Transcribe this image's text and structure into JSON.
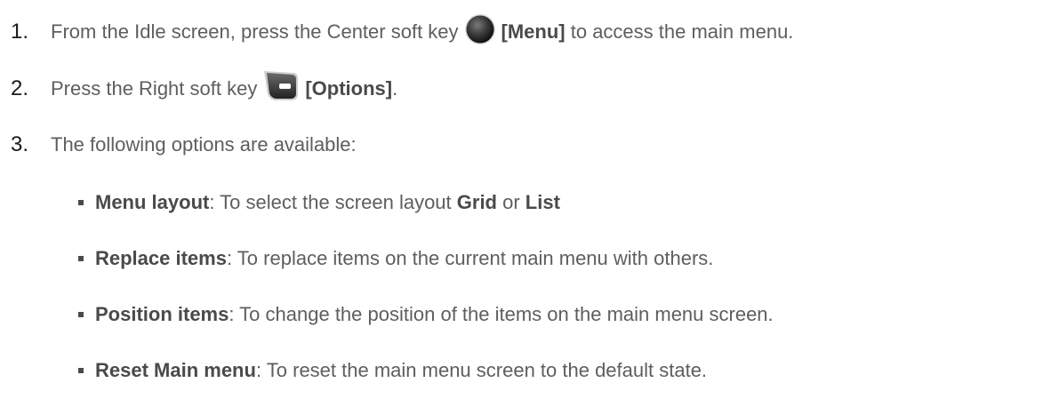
{
  "steps": [
    {
      "number": "1.",
      "text_before": "From the Idle screen, press the Center soft key",
      "key_label": "[Menu]",
      "text_after": " to access the main menu."
    },
    {
      "number": "2.",
      "text_before": "Press the Right soft key",
      "key_label": "[Options]",
      "text_after": "."
    },
    {
      "number": "3.",
      "text": "The following options are available:"
    }
  ],
  "options": [
    {
      "term": "Menu layout",
      "desc": ": To select the screen layout ",
      "choice1": "Grid",
      "connector": " or ",
      "choice2": "List"
    },
    {
      "term": "Replace items",
      "desc": ": To replace items on the current main menu with others."
    },
    {
      "term": "Position items",
      "desc": ": To change the position of the items on the main menu screen."
    },
    {
      "term": "Reset Main menu",
      "desc": ": To reset the main menu screen to the default state."
    }
  ],
  "icons": {
    "center_key": "center-soft-key-icon",
    "right_key": "right-soft-key-icon"
  },
  "colors": {
    "body_text": "#5e5e5e",
    "number_text": "#1a1a1a",
    "bold_text": "#4a4a4a"
  }
}
